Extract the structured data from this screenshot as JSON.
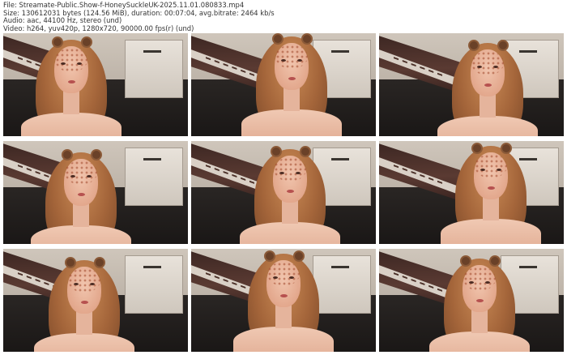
{
  "header": {
    "file_line": "File: Streamate-Public.Show-f-HoneySuckleUK-2025.11.01.080833.mp4",
    "size_line": "Size: 130612031 bytes (124.56 MiB), duration: 00:07:04, avg.bitrate: 2464 kb/s",
    "audio_line": "Audio: aac, 44100 Hz, stereo (und)",
    "video_line": "Video: h264, yuv420p, 1280x720, 90000.00 fps(r) (und)"
  },
  "thumbnails": [
    {
      "name": "thumbnail-1"
    },
    {
      "name": "thumbnail-2"
    },
    {
      "name": "thumbnail-3"
    },
    {
      "name": "thumbnail-4"
    },
    {
      "name": "thumbnail-5"
    },
    {
      "name": "thumbnail-6"
    },
    {
      "name": "thumbnail-7"
    },
    {
      "name": "thumbnail-8"
    },
    {
      "name": "thumbnail-9"
    }
  ]
}
